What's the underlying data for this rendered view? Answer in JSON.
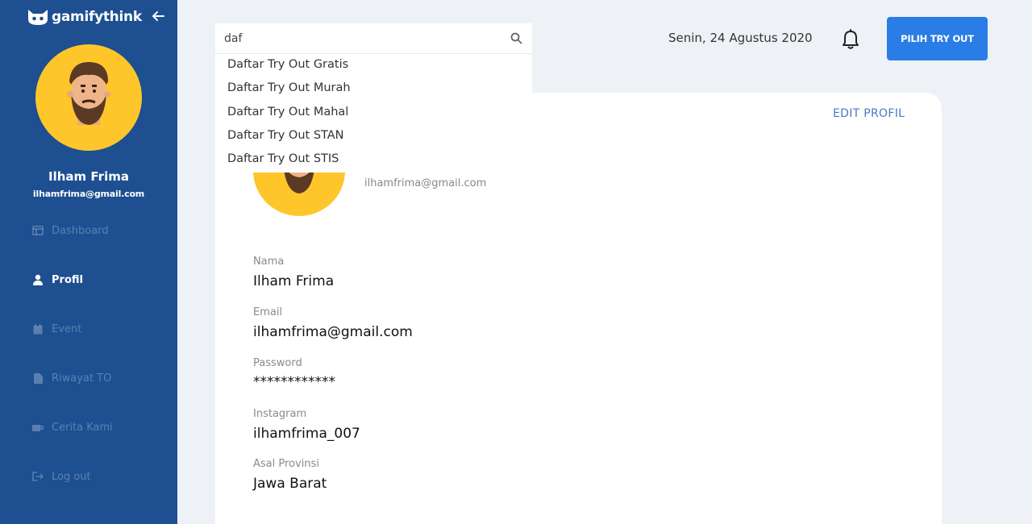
{
  "sidebar": {
    "brand": "gamifythink",
    "user_name": "Ilham Frima",
    "user_email": "ilhamfrima@gmail.com",
    "items": [
      {
        "label": "Dashboard",
        "icon": "dashboard-icon",
        "active": false
      },
      {
        "label": "Profil",
        "icon": "user-icon",
        "active": true
      },
      {
        "label": "Event",
        "icon": "calendar-icon",
        "active": false
      },
      {
        "label": "Riwayat TO",
        "icon": "document-icon",
        "active": false
      },
      {
        "label": "Cerita Kami",
        "icon": "coffee-icon",
        "active": false
      },
      {
        "label": "Log out",
        "icon": "logout-icon",
        "active": false
      }
    ]
  },
  "search": {
    "value": "daf",
    "suggestions": [
      "Daftar Try Out Gratis",
      "Daftar Try Out Murah",
      "Daftar Try Out Mahal",
      "Daftar Try Out STAN",
      "Daftar Try Out STIS"
    ]
  },
  "header": {
    "date": "Senin, 24 Agustus 2020",
    "cta_label": "PILIH TRY OUT"
  },
  "profile": {
    "edit_label": "EDIT PROFIL",
    "email_under_avatar": "ilhamfrima@gmail.com",
    "fields": [
      {
        "label": "Nama",
        "value": "Ilham Frima"
      },
      {
        "label": "Email",
        "value": "ilhamfrima@gmail.com"
      },
      {
        "label": "Password",
        "value": "************"
      },
      {
        "label": "Instagram",
        "value": "ilhamfrima_007"
      },
      {
        "label": "Asal Provinsi",
        "value": "Jawa Barat"
      }
    ]
  },
  "colors": {
    "sidebar": "#1d4f91",
    "accent": "#2a7ce6",
    "avatar_bg": "#ffc62b",
    "page_bg": "#eef2f7"
  }
}
